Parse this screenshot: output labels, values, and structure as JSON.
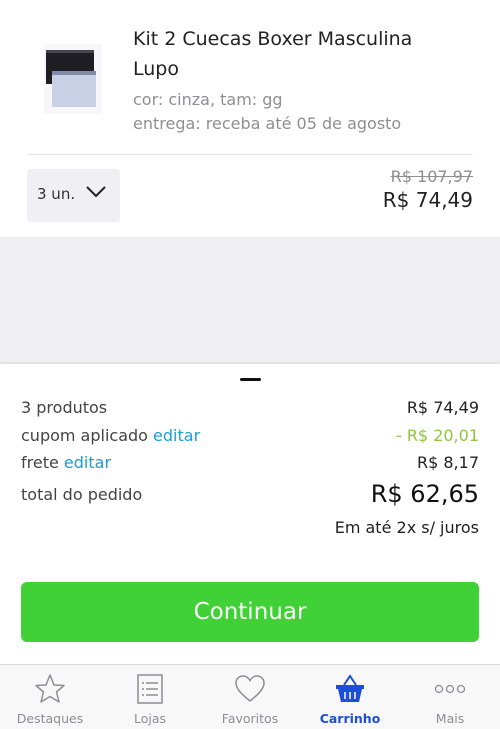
{
  "product": {
    "title": "Kit 2 Cuecas Boxer Masculina Lupo",
    "attributes": "cor: cinza, tam: gg",
    "delivery": "entrega: receba até 05 de agosto",
    "quantity": "3 un.",
    "old_price": "R$ 107,97",
    "price": "R$ 74,49"
  },
  "summary": {
    "products_label": "3 produtos",
    "products_value": "R$ 74,49",
    "coupon_label": "cupom aplicado",
    "coupon_edit": "editar",
    "coupon_value": "- R$ 20,01",
    "shipping_label": "frete",
    "shipping_edit": "editar",
    "shipping_value": "R$ 8,17",
    "total_label": "total do pedido",
    "total_value": "R$ 62,65",
    "installments": "Em até 2x s/ juros",
    "continue_label": "Continuar"
  },
  "tabs": [
    {
      "label": "Destaques",
      "icon": "star-icon"
    },
    {
      "label": "Lojas",
      "icon": "list-icon"
    },
    {
      "label": "Favoritos",
      "icon": "heart-icon"
    },
    {
      "label": "Carrinho",
      "icon": "basket-icon",
      "active": true
    },
    {
      "label": "Mais",
      "icon": "more-icon"
    }
  ],
  "colors": {
    "accent_green": "#3fd135",
    "link_blue": "#1a9fd6",
    "discount_green": "#8cc63f",
    "active_tab": "#1a4fd6"
  }
}
